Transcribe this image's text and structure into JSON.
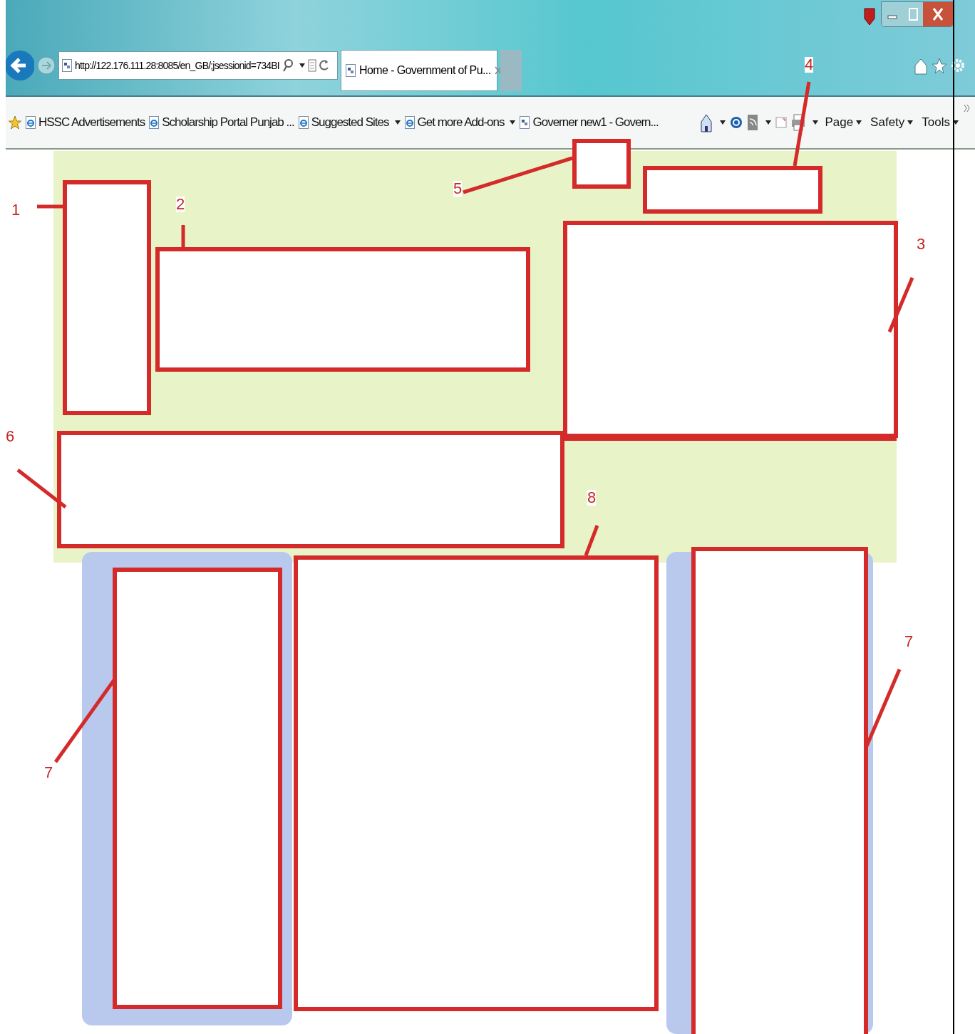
{
  "address": {
    "url": "http://122.176.111.28:8085/en_GB/;jsessionid=734BI"
  },
  "tab": {
    "title": "Home - Government of Pu..."
  },
  "favorites": [
    {
      "label": "HSSC  Advertisements",
      "kind": "ie",
      "dropdown": false
    },
    {
      "label": "Scholarship Portal Punjab ...",
      "kind": "ie",
      "dropdown": false
    },
    {
      "label": "Suggested Sites",
      "kind": "ie",
      "dropdown": true
    },
    {
      "label": "Get more Add-ons",
      "kind": "ie",
      "dropdown": true
    },
    {
      "label": "Governer new1 - Govern...",
      "kind": "page",
      "dropdown": false
    }
  ],
  "command_menus": [
    "Page",
    "Safety",
    "Tools"
  ],
  "annotations": [
    {
      "label": "1"
    },
    {
      "label": "2"
    },
    {
      "label": "3"
    },
    {
      "label": "4"
    },
    {
      "label": "5"
    },
    {
      "label": "6"
    },
    {
      "label": "7"
    },
    {
      "label": "8"
    },
    {
      "label": "7"
    }
  ]
}
